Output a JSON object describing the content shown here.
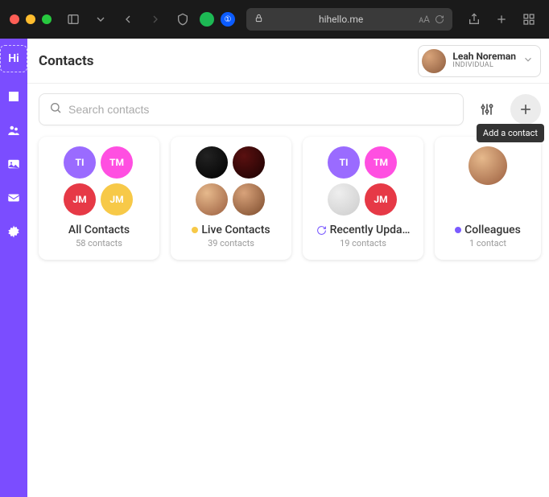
{
  "browser": {
    "url": "hihello.me"
  },
  "sidebar": {
    "logo": "Hi"
  },
  "header": {
    "title": "Contacts",
    "user": {
      "name": "Leah Noreman",
      "plan": "INDIVIDUAL"
    }
  },
  "toolbar": {
    "search_placeholder": "Search contacts",
    "tooltip_add": "Add a contact"
  },
  "colors": {
    "purple": "#9a6bff",
    "magenta": "#ff4fe1",
    "red": "#e63946",
    "yellow": "#f7c948",
    "accent": "#7b4dff"
  },
  "groups": [
    {
      "title": "All Contacts",
      "count_label": "58 contacts",
      "icon": null,
      "avatars": [
        {
          "type": "initials",
          "text": "TI",
          "bg": "#9a6bff"
        },
        {
          "type": "initials",
          "text": "TM",
          "bg": "#ff4fe1"
        },
        {
          "type": "initials",
          "text": "JM",
          "bg": "#e63946"
        },
        {
          "type": "initials",
          "text": "JM",
          "bg": "#f7c948"
        }
      ]
    },
    {
      "title": "Live Contacts",
      "count_label": "39 contacts",
      "icon": {
        "type": "bullet",
        "color": "#f7c948"
      },
      "avatars": [
        {
          "type": "photo",
          "class": "photo3"
        },
        {
          "type": "photo",
          "class": "photo4"
        },
        {
          "type": "photo",
          "class": "photo"
        },
        {
          "type": "photo",
          "class": "photo2"
        }
      ]
    },
    {
      "title": "Recently Upda…",
      "count_label": "19 contacts",
      "icon": {
        "type": "refresh"
      },
      "avatars": [
        {
          "type": "initials",
          "text": "TI",
          "bg": "#9a6bff"
        },
        {
          "type": "initials",
          "text": "TM",
          "bg": "#ff4fe1"
        },
        {
          "type": "photo",
          "class": "photo5"
        },
        {
          "type": "initials",
          "text": "JM",
          "bg": "#e63946"
        }
      ]
    },
    {
      "title": "Colleagues",
      "count_label": "1 contact",
      "icon": {
        "type": "bullet",
        "color": "#7b5bff"
      },
      "avatars": [
        {
          "type": "photo",
          "class": "photo",
          "big": true
        }
      ]
    }
  ]
}
